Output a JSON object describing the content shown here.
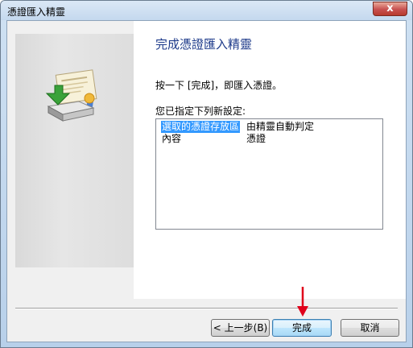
{
  "window": {
    "title": "憑證匯入精靈",
    "close_label": "x"
  },
  "main": {
    "heading": "完成憑證匯入精靈",
    "instruction": "按一下 [完成]，即匯入憑證。",
    "settings_label": "您已指定下列新設定:",
    "settings": [
      {
        "key": "選取的憑證存放區",
        "value": "由精靈自動判定"
      },
      {
        "key": "內容",
        "value": "憑證"
      }
    ]
  },
  "buttons": {
    "back": "< 上一步(B)",
    "finish": "完成",
    "cancel": "取消"
  },
  "colors": {
    "heading": "#1d3a8a",
    "selection": "#3399ff",
    "annotation_arrow": "#e0001a"
  },
  "icons": {
    "wizard": "certificate-import-icon",
    "annotation": "red-arrow-icon"
  }
}
